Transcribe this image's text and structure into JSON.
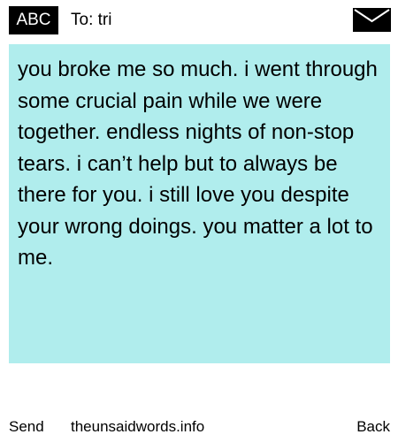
{
  "header": {
    "badge_label": "ABC",
    "recipient_label": "To: tri",
    "mail_icon": "envelope-icon"
  },
  "message": {
    "body": "you broke me so much. i went through some crucial pain while we were together. endless nights of non-stop tears. i can’t help but to always be there for you. i still love you despite your wrong doings. you matter a lot to me.",
    "background_color": "#b0eded"
  },
  "footer": {
    "send_label": "Send",
    "site_label": "theunsaidwords.info",
    "back_label": "Back"
  }
}
